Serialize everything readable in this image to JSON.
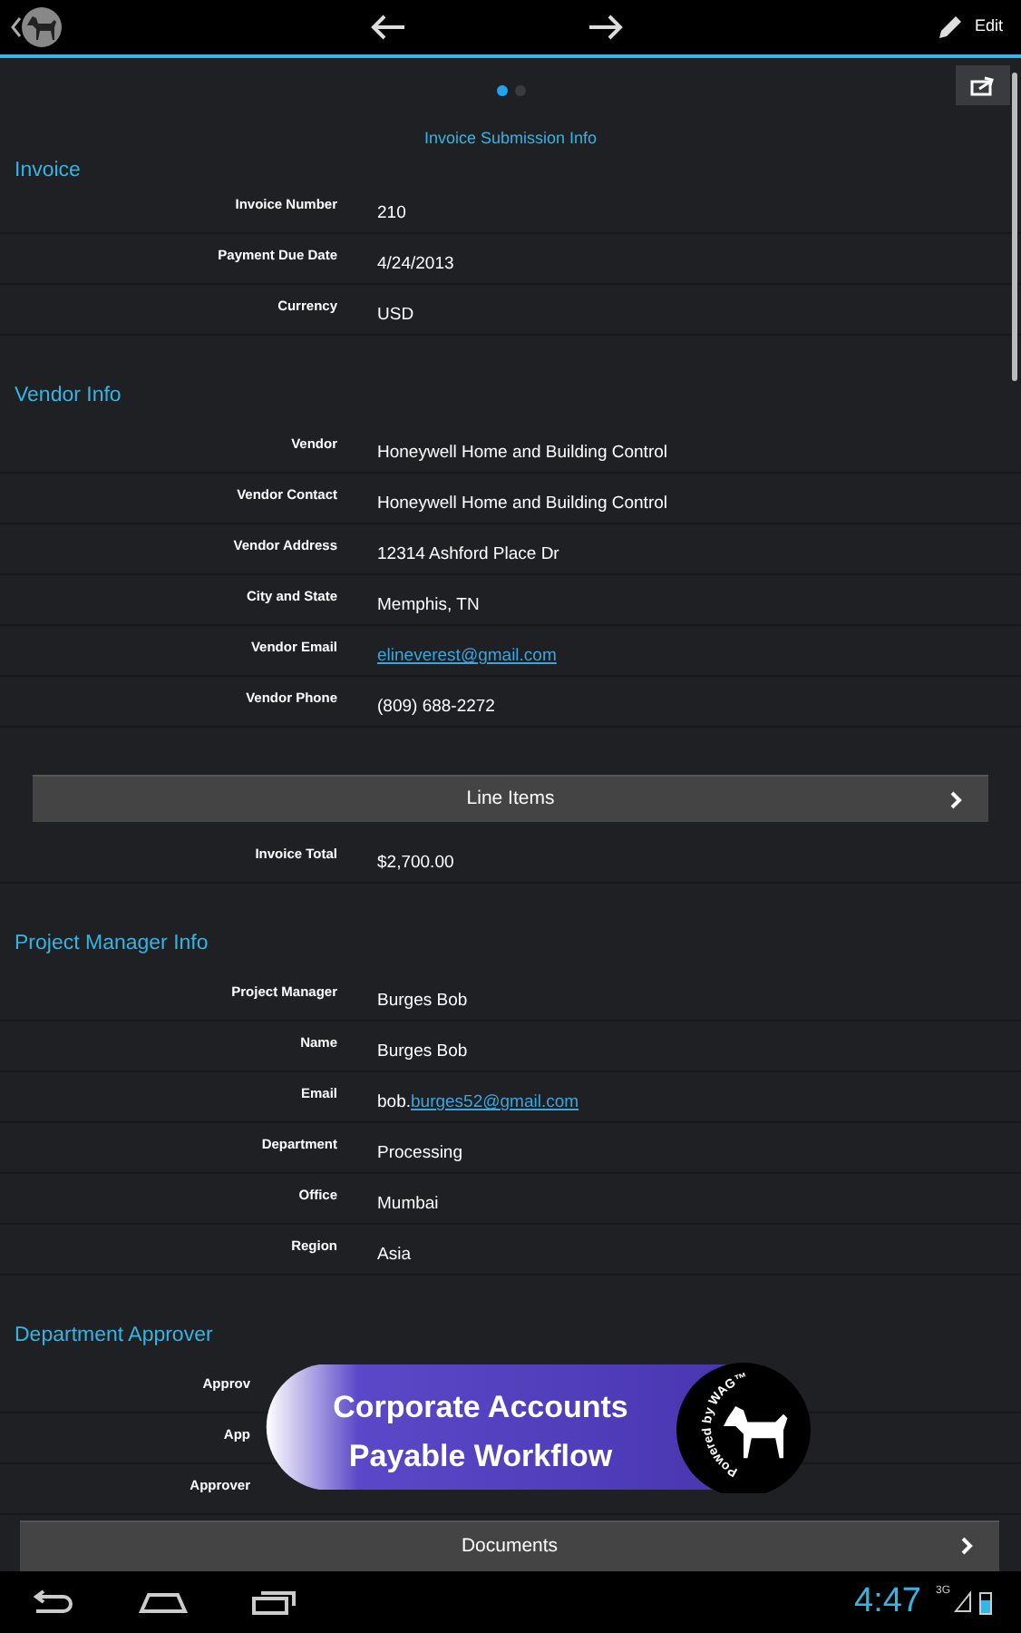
{
  "action_bar": {
    "edit_label": "Edit"
  },
  "pager": {
    "dots": [
      {
        "selected": true
      },
      {
        "selected": false
      }
    ],
    "title": "Invoice Submission Info"
  },
  "content": [
    {
      "kind": "heading",
      "text": "Invoice"
    },
    {
      "kind": "field",
      "label": "Invoice Number",
      "value": "210"
    },
    {
      "kind": "field",
      "label": "Payment Due Date",
      "value": "4/24/2013"
    },
    {
      "kind": "field",
      "label": "Currency",
      "value": "USD"
    },
    {
      "kind": "heading",
      "text": "Vendor Info"
    },
    {
      "kind": "field",
      "label": "Vendor",
      "value": "Honeywell Home and Building Control"
    },
    {
      "kind": "field",
      "label": "Vendor Contact",
      "value": "Honeywell Home and Building Control"
    },
    {
      "kind": "field",
      "label": "Vendor Address",
      "value": "12314 Ashford Place Dr"
    },
    {
      "kind": "field",
      "label": "City and State",
      "value": "Memphis, TN"
    },
    {
      "kind": "field",
      "label": "Vendor Email",
      "link": "elineverest@gmail.com"
    },
    {
      "kind": "field",
      "label": "Vendor Phone",
      "value": "(809) 688-2272"
    },
    {
      "kind": "nav_button",
      "label": "Line Items"
    },
    {
      "kind": "field",
      "label": "Invoice Total",
      "value": "$2,700.00"
    },
    {
      "kind": "heading",
      "text": "Project Manager Info"
    },
    {
      "kind": "field",
      "label": "Project Manager",
      "value": "Burges Bob"
    },
    {
      "kind": "field",
      "label": "Name",
      "value": "Burges Bob"
    },
    {
      "kind": "field",
      "label": "Email",
      "value": "bob.",
      "link": "burges52@gmail.com"
    },
    {
      "kind": "field",
      "label": "Department",
      "value": "Processing"
    },
    {
      "kind": "field",
      "label": "Office",
      "value": "Mumbai"
    },
    {
      "kind": "field",
      "label": "Region",
      "value": "Asia"
    },
    {
      "kind": "heading",
      "text": "Department Approver"
    },
    {
      "kind": "covered_field",
      "label": "Approv"
    },
    {
      "kind": "covered_field",
      "label": "App"
    },
    {
      "kind": "covered_field",
      "label": "Approver"
    },
    {
      "kind": "nav_button",
      "label": "Documents"
    }
  ],
  "banner": {
    "lines": [
      "Corporate Accounts",
      "Payable Workflow"
    ],
    "badge_text": "Powered by WAG™"
  },
  "status_bar": {
    "time": "4:47",
    "network": "3G"
  }
}
